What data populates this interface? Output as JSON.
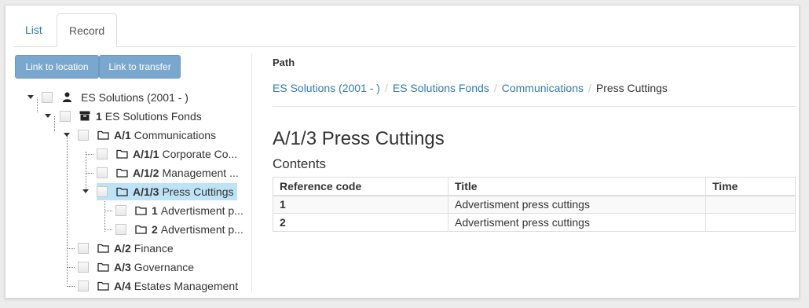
{
  "tabs": [
    {
      "label": "List"
    },
    {
      "label": "Record"
    }
  ],
  "buttons": {
    "link_location": "Link to location",
    "link_transfer": "Link to transfer"
  },
  "tree": [
    {
      "code": "",
      "title": "ES Solutions (2001 - )",
      "icon": "person-icon"
    },
    {
      "code": "1",
      "title": "ES Solutions Fonds",
      "icon": "archive-box-icon"
    },
    {
      "code": "A/1",
      "title": "Communications",
      "icon": "folder-icon"
    },
    {
      "code": "A/1/1",
      "title": "Corporate Co...",
      "icon": "folder-icon"
    },
    {
      "code": "A/1/2",
      "title": "Management ...",
      "icon": "folder-icon"
    },
    {
      "code": "A/1/3",
      "title": "Press Cuttings",
      "icon": "folder-icon",
      "selected": true
    },
    {
      "code": "1",
      "title": "Advertisment p...",
      "icon": "folder-icon"
    },
    {
      "code": "2",
      "title": "Advertisment p...",
      "icon": "folder-icon"
    },
    {
      "code": "A/2",
      "title": "Finance",
      "icon": "folder-icon"
    },
    {
      "code": "A/3",
      "title": "Governance",
      "icon": "folder-icon"
    },
    {
      "code": "A/4",
      "title": "Estates Management",
      "icon": "folder-icon"
    }
  ],
  "path": {
    "label": "Path",
    "crumbs": [
      "ES Solutions (2001 - )",
      "ES Solutions Fonds",
      "Communications"
    ],
    "current": "Press Cuttings"
  },
  "record": {
    "heading": "A/1/3 Press Cuttings",
    "contents_label": "Contents",
    "columns": [
      "Reference code",
      "Title",
      "Time"
    ],
    "rows": [
      {
        "ref": "1",
        "title": "Advertisment press cuttings",
        "time": ""
      },
      {
        "ref": "2",
        "title": "Advertisment press cuttings",
        "time": ""
      }
    ]
  },
  "colors": {
    "link": "#337ab7",
    "button": "#7aa7cd",
    "selected": "#bfe3f6"
  }
}
